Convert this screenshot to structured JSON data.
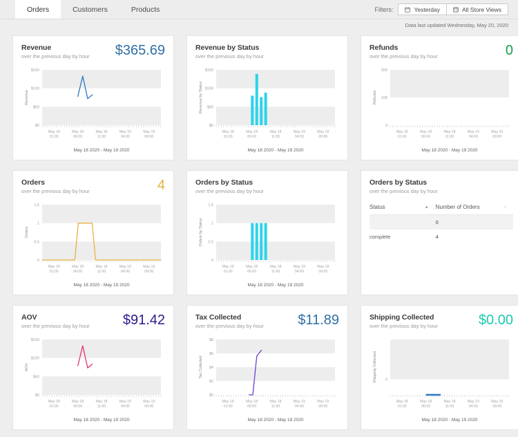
{
  "nav": {
    "tabs": [
      {
        "label": "Orders",
        "active": true
      },
      {
        "label": "Customers",
        "active": false
      },
      {
        "label": "Products",
        "active": false
      }
    ]
  },
  "filters": {
    "label": "Filters:",
    "date_filter": "Yesterday",
    "date_filter_icon": "calendar-icon",
    "store_filter": "All Store Views",
    "store_filter_icon": "store-icon"
  },
  "updated": {
    "text": "Data last updated Wednesday, May 20, 2020"
  },
  "colors": {
    "revenue": "#2f6ea5",
    "cyan": "#2bd4ea",
    "green": "#12a150",
    "amber": "#e5b33c",
    "indigo": "#2e1a8c",
    "pink": "#e0356b",
    "purple": "#6b3fd4",
    "teal": "#1ec8b0",
    "blue_line": "#2f78c4"
  },
  "cards": [
    {
      "title": "Revenue",
      "subtitle": "over the previous day by hour",
      "value": "$365.69",
      "value_color": "#2f6ea5",
      "kind": "line",
      "chart_data": {
        "type": "line",
        "title": "Revenue",
        "ylabel": "Revenue",
        "xlabel": "",
        "caption": "May 18 2020 - May 19 2020",
        "yticks": [
          "$150",
          "$100",
          "$50",
          "$0"
        ],
        "ylim": [
          0,
          150
        ],
        "xticks": [
          "May 18\n01:00",
          "May 18\n06:00",
          "May 18\n11:00",
          "May 19\n04:00",
          "May 19\n09:00"
        ],
        "line_color": "#2f78c4",
        "points": [
          {
            "x": 7.2,
            "y": 77
          },
          {
            "x": 8.2,
            "y": 133
          },
          {
            "x": 9.2,
            "y": 72
          },
          {
            "x": 10.2,
            "y": 83
          }
        ],
        "grid_bands": true
      }
    },
    {
      "title": "Revenue by Status",
      "subtitle": "over the previous day by hour",
      "value": "",
      "value_color": "#2f6ea5",
      "kind": "bar",
      "chart_data": {
        "type": "bar",
        "title": "Revenue by Status",
        "ylabel": "Revenue by Status",
        "xlabel": "",
        "caption": "May 18 2020 - May 19 2020",
        "yticks": [
          "$150",
          "$100",
          "$50",
          "$0"
        ],
        "ylim": [
          0,
          150
        ],
        "xticks": [
          "May 18\n01:00",
          "May 18\n06:00",
          "May 18\n11:00",
          "May 19\n04:00",
          "May 19\n09:00"
        ],
        "bar_color": "#2bd4ea",
        "bars": [
          {
            "x": 7.3,
            "value": 80
          },
          {
            "x": 8.2,
            "value": 139
          },
          {
            "x": 9.1,
            "value": 76
          },
          {
            "x": 10.0,
            "value": 88
          }
        ]
      }
    },
    {
      "title": "Refunds",
      "subtitle": "over the previous day by hour",
      "value": "0",
      "value_color": "#12a150",
      "kind": "empty",
      "chart_data": {
        "type": "line",
        "title": "Refunds",
        "ylabel": "Refunds",
        "xlabel": "",
        "caption": "May 18 2020 - May 19 2020",
        "yticks": [
          "200",
          "100",
          "0"
        ],
        "ylim": [
          0,
          200
        ],
        "xticks": [
          "May 18\n01:00",
          "May 18\n06:00",
          "May 18\n11:00",
          "May 19\n04:00",
          "May 19\n09:00"
        ],
        "points": []
      }
    },
    {
      "title": "Orders",
      "subtitle": "over the previous day by hour",
      "value": "4",
      "value_color": "#e5b33c",
      "kind": "line",
      "chart_data": {
        "type": "line",
        "title": "Orders",
        "ylabel": "Orders",
        "xlabel": "",
        "caption": "May 18 2020 - May 19 2020",
        "yticks": [
          "1.5",
          "1",
          "0.5",
          "0"
        ],
        "ylim": [
          0,
          1.5
        ],
        "xticks": [
          "May 18\n01:00",
          "May 18\n06:00",
          "May 18\n11:00",
          "May 19\n04:00",
          "May 19\n09:00"
        ],
        "line_color": "#e5b33c",
        "points": [
          {
            "x": 0,
            "y": 0
          },
          {
            "x": 6.6,
            "y": 0
          },
          {
            "x": 7.3,
            "y": 1
          },
          {
            "x": 10.1,
            "y": 1
          },
          {
            "x": 10.8,
            "y": 0
          },
          {
            "x": 24,
            "y": 0
          }
        ]
      }
    },
    {
      "title": "Orders by Status",
      "subtitle": "over the previous day by hour",
      "value": "",
      "value_color": "#2bd4ea",
      "kind": "bar",
      "chart_data": {
        "type": "bar",
        "title": "Orders by Status",
        "ylabel": "Orders by Status",
        "xlabel": "",
        "caption": "May 18 2020 - May 19 2020",
        "yticks": [
          "1.5",
          "1",
          "0.5",
          "0"
        ],
        "ylim": [
          0,
          1.5
        ],
        "xticks": [
          "May 18\n01:00",
          "May 18\n06:00",
          "May 18\n11:00",
          "May 19\n04:00",
          "May 19\n09:00"
        ],
        "bar_color": "#2bd4ea",
        "bars": [
          {
            "x": 7.3,
            "value": 1
          },
          {
            "x": 8.2,
            "value": 1
          },
          {
            "x": 9.1,
            "value": 1
          },
          {
            "x": 10.0,
            "value": 1
          }
        ]
      }
    },
    {
      "title": "Orders by Status",
      "subtitle": "over the previous day by hour",
      "value": "",
      "kind": "table",
      "table": {
        "columns": [
          "Status",
          "Number of Orders"
        ],
        "sort_indicator": "▲",
        "menu_indicator": "↕",
        "rows": [
          {
            "status": "",
            "orders": "0"
          },
          {
            "status": "complete",
            "orders": "4"
          }
        ]
      }
    },
    {
      "title": "AOV",
      "subtitle": "over the previous day by hour",
      "value": "$91.42",
      "value_color": "#2e1a8c",
      "kind": "line",
      "chart_data": {
        "type": "line",
        "title": "AOV",
        "ylabel": "AOV",
        "xlabel": "",
        "caption": "May 18 2020 - May 19 2020",
        "yticks": [
          "$150",
          "$100",
          "$50",
          "$0"
        ],
        "ylim": [
          0,
          150
        ],
        "xticks": [
          "May 18\n01:00",
          "May 18\n06:00",
          "May 18\n11:00",
          "May 19\n04:00",
          "May 19\n09:00"
        ],
        "line_color": "#e0356b",
        "points": [
          {
            "x": 7.2,
            "y": 78
          },
          {
            "x": 8.2,
            "y": 133
          },
          {
            "x": 9.2,
            "y": 73
          },
          {
            "x": 10.2,
            "y": 84
          }
        ]
      }
    },
    {
      "title": "Tax Collected",
      "subtitle": "over the previous day by hour",
      "value": "$11.89",
      "value_color": "#2f6ea5",
      "kind": "line",
      "chart_data": {
        "type": "line",
        "title": "Tax Collected",
        "ylabel": "Tax Collected",
        "xlabel": "",
        "caption": "May 18 2020 - May 19 2020",
        "yticks": [
          "$8",
          "$6",
          "$4",
          "$2",
          "$0"
        ],
        "ylim": [
          0,
          8
        ],
        "xticks": [
          "May 18\n01:00",
          "May 18\n06:00",
          "May 18\n11:00",
          "May 19\n04:00",
          "May 19\n09:00"
        ],
        "line_color": "#6b3fd4",
        "points": [
          {
            "x": 6.6,
            "y": 0
          },
          {
            "x": 7.4,
            "y": 0
          },
          {
            "x": 8.2,
            "y": 5.6
          },
          {
            "x": 9.2,
            "y": 6.5
          }
        ]
      }
    },
    {
      "title": "Shipping Collected",
      "subtitle": "over the previous day by hour",
      "value": "$0.00",
      "value_color": "#1ec8b0",
      "kind": "line",
      "chart_data": {
        "type": "line",
        "title": "Shipping Collected",
        "ylabel": "Shipping Collected",
        "xlabel": "",
        "caption": "May 18 2020 - May 19 2020",
        "yticks": [
          "0"
        ],
        "ylim": [
          0,
          1
        ],
        "xticks": [
          "May 18\n01:00",
          "May 18\n06:00",
          "May 18\n11:00",
          "May 19\n04:00",
          "May 19\n09:00"
        ],
        "line_color": "#2f78c4",
        "points": [
          {
            "x": 7.2,
            "y": 0
          },
          {
            "x": 10.2,
            "y": 0
          }
        ]
      }
    }
  ]
}
